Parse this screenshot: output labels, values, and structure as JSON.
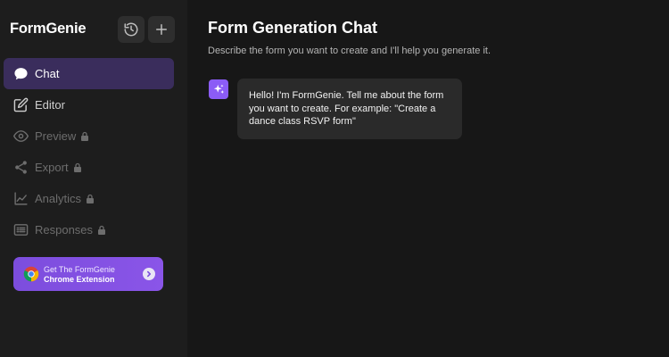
{
  "sidebar": {
    "brand": "FormGenie",
    "history_button": {
      "icon": "history-icon"
    },
    "new_chat_button": {
      "icon": "plus-icon"
    },
    "nav": [
      {
        "label": "Chat",
        "icon": "chat-bubble-icon",
        "active": true,
        "locked": false
      },
      {
        "label": "Editor",
        "icon": "edit-icon",
        "active": false,
        "locked": false
      },
      {
        "label": "Preview",
        "icon": "eye-icon",
        "active": false,
        "locked": true
      },
      {
        "label": "Export",
        "icon": "share-icon",
        "active": false,
        "locked": true
      },
      {
        "label": "Analytics",
        "icon": "line-chart-icon",
        "active": false,
        "locked": true
      },
      {
        "label": "Responses",
        "icon": "list-icon",
        "active": false,
        "locked": true
      }
    ],
    "promo": {
      "line1": "Get The FormGenie",
      "line2": "Chrome Extension",
      "icon": "chrome-icon"
    }
  },
  "main": {
    "title": "Form Generation Chat",
    "subtitle": "Describe the form you want to create and I'll help you generate it.",
    "messages": [
      {
        "role": "assistant",
        "icon": "sparkles-icon",
        "text": "Hello! I'm FormGenie. Tell me about the form you want to create. For example: \"Create a dance class RSVP form\""
      }
    ]
  },
  "colors": {
    "background": "#171717",
    "sidebar": "#1d1d1d",
    "active_nav": "#3a2d5c",
    "accent": "#8b5cf6",
    "bubble": "#2a2a2a"
  }
}
